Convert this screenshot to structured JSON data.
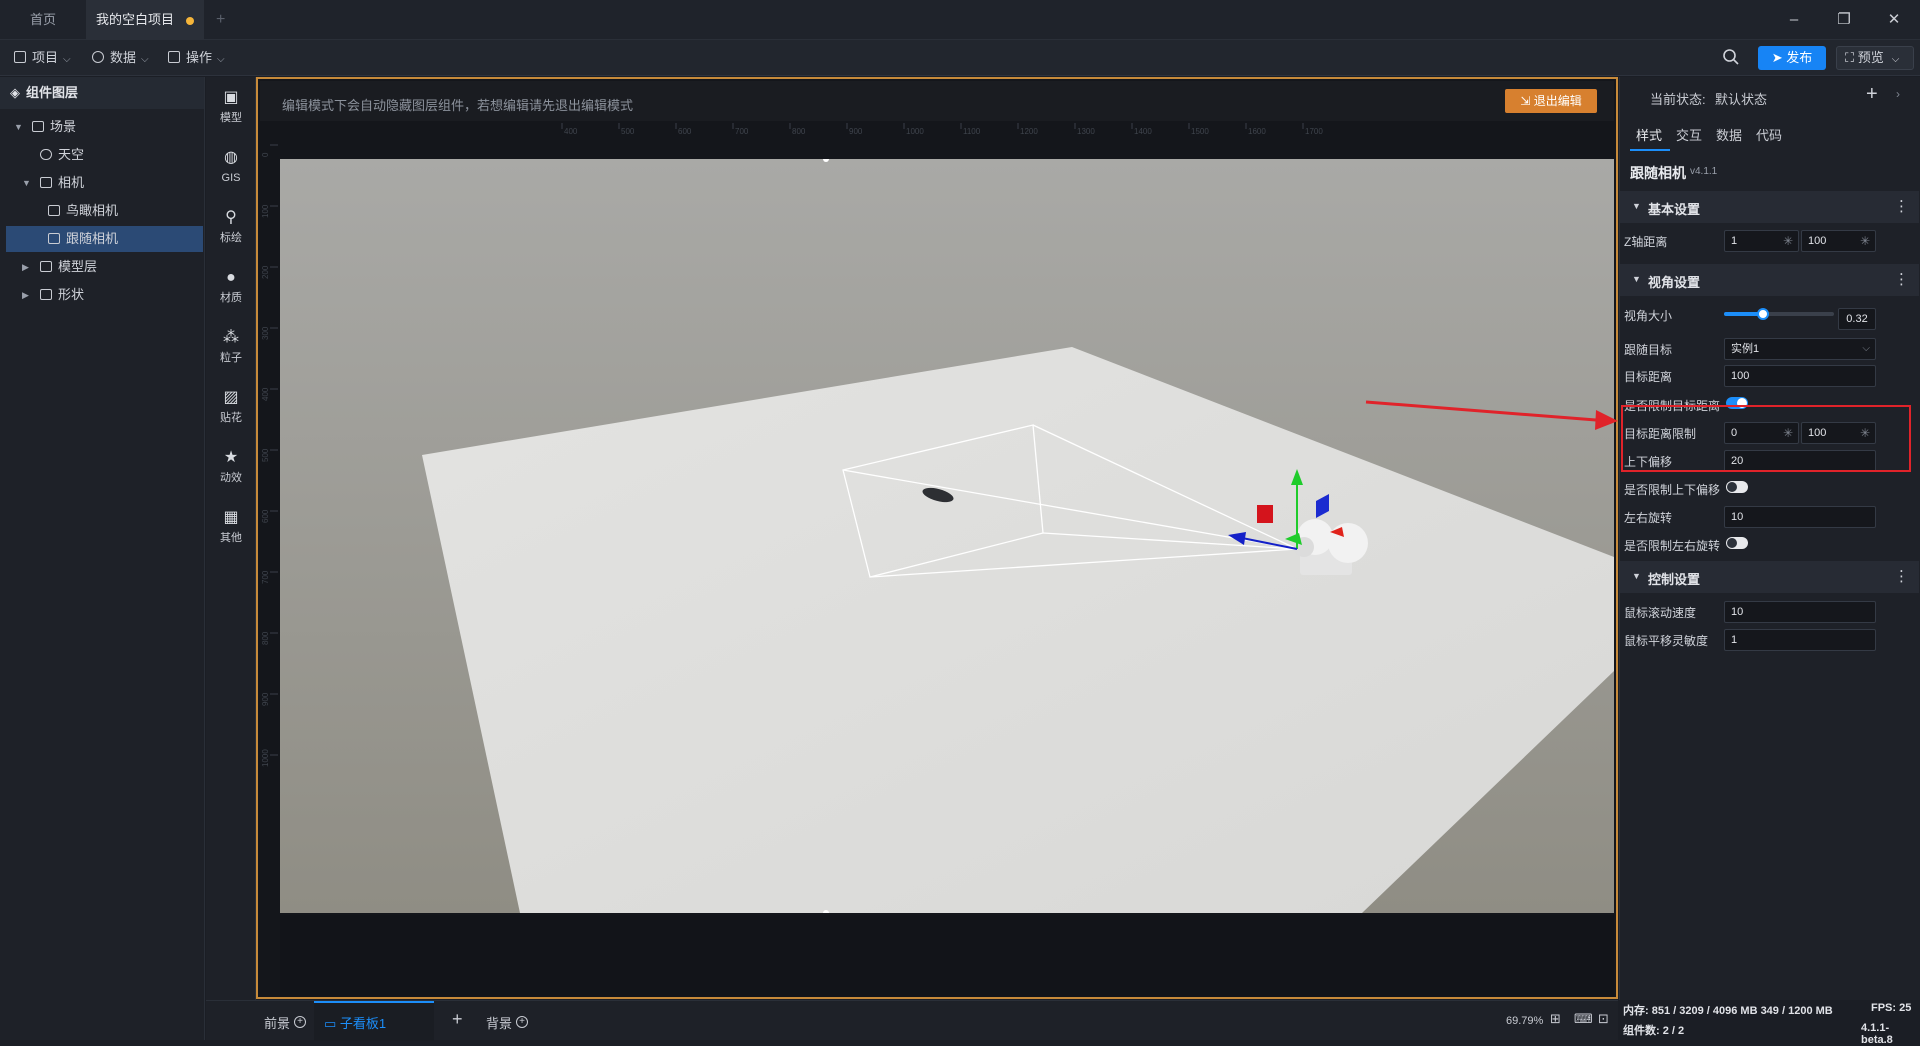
{
  "titlebar": {
    "tabs": [
      {
        "label": "首页",
        "active": false
      },
      {
        "label": "我的空白项目",
        "active": true,
        "unsaved_dot_color": "#f5b53a"
      }
    ],
    "new_tab_icon": "plus-icon",
    "window_controls": [
      "minimize-icon",
      "restore-icon",
      "close-icon"
    ]
  },
  "menubar": {
    "items": [
      {
        "label": "项目",
        "icon": "file-icon"
      },
      {
        "label": "数据",
        "icon": "database-icon"
      },
      {
        "label": "操作",
        "icon": "grid-icon"
      }
    ],
    "publish_label": "发布",
    "preview_label": "预览"
  },
  "layers": {
    "title": "组件图层",
    "tree": [
      {
        "label": "场景",
        "level": 0,
        "expanded": true,
        "icon": "scene-icon"
      },
      {
        "label": "天空",
        "level": 1,
        "icon": "sky-icon"
      },
      {
        "label": "相机",
        "level": 1,
        "expanded": true,
        "icon": "folder-icon"
      },
      {
        "label": "鸟瞰相机",
        "level": 2,
        "icon": "camera-icon"
      },
      {
        "label": "跟随相机",
        "level": 2,
        "icon": "camera-icon",
        "selected": true
      },
      {
        "label": "模型层",
        "level": 1,
        "expanded": false,
        "icon": "folder-icon"
      },
      {
        "label": "形状",
        "level": 1,
        "expanded": false,
        "icon": "folder-icon"
      }
    ]
  },
  "tools": [
    {
      "label": "模型",
      "icon": "model-icon"
    },
    {
      "label": "GIS",
      "icon": "globe-icon"
    },
    {
      "label": "标绘",
      "icon": "pin-icon"
    },
    {
      "label": "材质",
      "icon": "material-icon"
    },
    {
      "label": "粒子",
      "icon": "particle-icon"
    },
    {
      "label": "贴花",
      "icon": "decal-icon"
    },
    {
      "label": "动效",
      "icon": "effect-icon"
    },
    {
      "label": "其他",
      "icon": "more-grid-icon"
    }
  ],
  "canvas": {
    "hint": "编辑模式下会自动隐藏图层组件，若想编辑请先退出编辑模式",
    "exit_edit_label": "退出编辑",
    "ruler_top_ticks": [
      "400",
      "500",
      "600",
      "700",
      "800",
      "900",
      "1000",
      "1100",
      "1200",
      "1300",
      "1400",
      "1500",
      "1600",
      "1700"
    ],
    "ruler_left_ticks": [
      "0",
      "100",
      "200",
      "300",
      "400",
      "500",
      "600",
      "700",
      "800",
      "900",
      "1000"
    ]
  },
  "bottombar": {
    "tabs": [
      {
        "label": "前景",
        "active": false
      },
      {
        "label": "子看板1",
        "active": true
      },
      {
        "label": "背景",
        "active": false
      }
    ],
    "zoom": "69.79%"
  },
  "properties": {
    "current_state_label": "当前状态:",
    "current_state_value": "默认状态",
    "tabs": [
      {
        "label": "样式",
        "active": true
      },
      {
        "label": "交互",
        "active": false
      },
      {
        "label": "数据",
        "active": false
      },
      {
        "label": "代码",
        "active": false
      }
    ],
    "component_name": "跟随相机",
    "component_version": "v4.1.1",
    "sections": {
      "basic": {
        "title": "基本设置",
        "z_axis_label": "Z轴距离",
        "z_min": "1",
        "z_max": "100"
      },
      "view": {
        "title": "视角设置",
        "fov_label": "视角大小",
        "fov_value": "0.32",
        "fov_slider_fraction": 0.35,
        "target_label": "跟随目标",
        "target_value": "实例1",
        "target_distance_label": "目标距离",
        "target_distance_value": "100",
        "limit_distance_label": "是否限制目标距离",
        "limit_distance_on": true,
        "distance_limit_label": "目标距离限制",
        "distance_limit_min": "0",
        "distance_limit_max": "100",
        "vertical_offset_label": "上下偏移",
        "vertical_offset_value": "20",
        "limit_vertical_label": "是否限制上下偏移",
        "limit_vertical_on": false,
        "rotation_label": "左右旋转",
        "rotation_value": "10",
        "limit_rotation_label": "是否限制左右旋转",
        "limit_rotation_on": false
      },
      "control": {
        "title": "控制设置",
        "scroll_speed_label": "鼠标滚动速度",
        "scroll_speed_value": "10",
        "pan_sensitivity_label": "鼠标平移灵敏度",
        "pan_sensitivity_value": "1"
      }
    }
  },
  "status": {
    "memory": "内存:  851 / 3209 / 4096 MB  349 / 1200 MB",
    "fps": "FPS:  25",
    "component_count": "组件数: 2 / 2",
    "version": "4.1.1-beta.8"
  },
  "colors": {
    "accent": "#1c8ef9",
    "publish": "#1784f5",
    "exit_edit": "#d7802f",
    "canvas_border": "#c78a3a",
    "highlight": "#e0232a"
  }
}
